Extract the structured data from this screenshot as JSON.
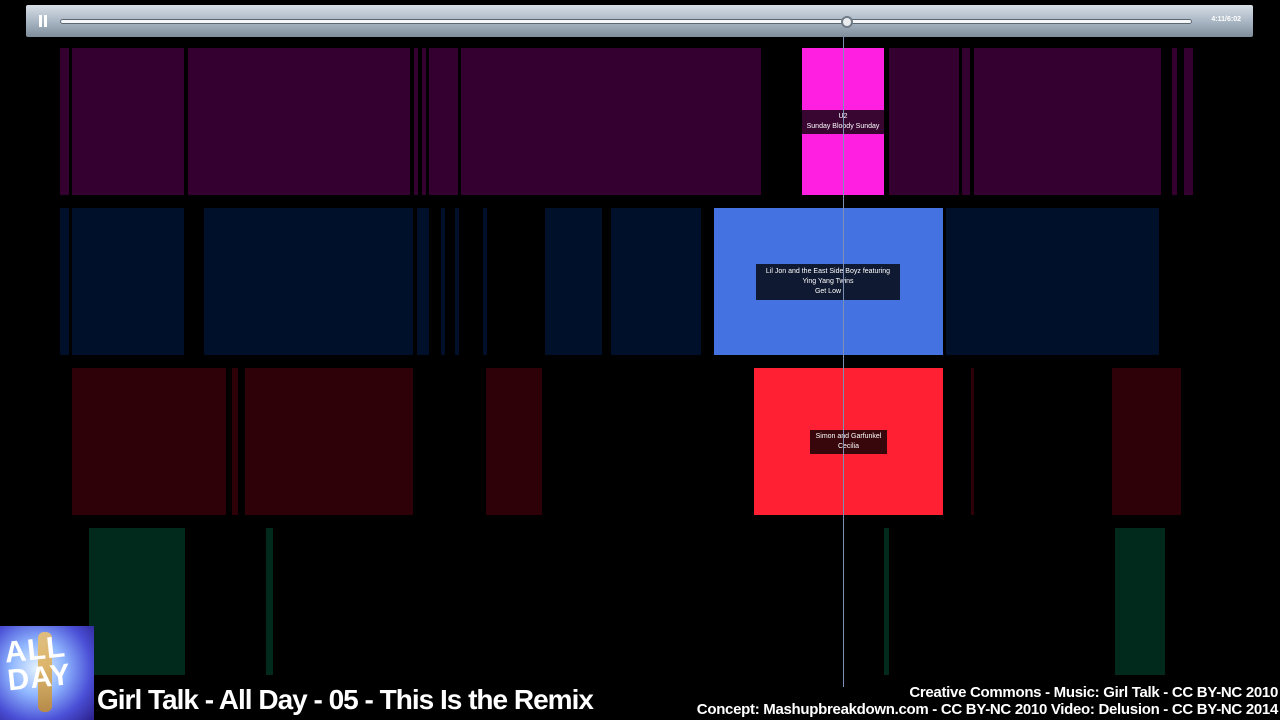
{
  "player": {
    "time_readout": "4:11/6:02",
    "progress_fraction": 0.695
  },
  "colors": {
    "lane1_dim": "#330030",
    "lane1_active": "#ff1fe0",
    "lane2_dim": "#00102a",
    "lane2_active": "#4472e0",
    "lane3_dim": "#2e0007",
    "lane3_active": "#ff2034",
    "lane4_dim": "#012a1c",
    "playhead": "#7c8fb5"
  },
  "tracks": {
    "u2": {
      "artist": "U2",
      "song": "Sunday Bloody Sunday"
    },
    "liljon": {
      "artist_line1": "Lil Jon and the East Side Boyz featuring",
      "artist_line2": "Ying Yang Twins",
      "song": "Get Low"
    },
    "simon": {
      "artist": "Simon and Garfunkel",
      "song": "Cecilia"
    }
  },
  "footer": {
    "cover_art_text": "ALL DAY",
    "title": "Girl Talk - All Day - 05 - This Is the Remix",
    "credit_line1": "Creative Commons - Music:  Girl Talk - CC BY-NC 2010",
    "credit_line2": "Concept:  Mashupbreakdown.com - CC BY-NC 2010   Video:  Delusion  - CC BY-NC 2014"
  }
}
